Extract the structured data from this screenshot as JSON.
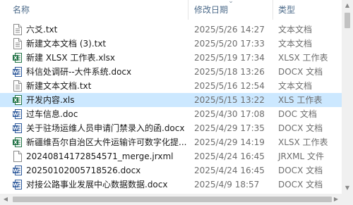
{
  "header": {
    "name": "名称",
    "date": "修改日期",
    "type": "类型"
  },
  "files": [
    {
      "name": "六爻.txt",
      "date": "2025/5/26 14:27",
      "type": "文本文档",
      "icon": "txt-file-icon",
      "selected": false
    },
    {
      "name": "新建文本文档 (3).txt",
      "date": "2025/5/20 17:33",
      "type": "文本文档",
      "icon": "txt-file-icon",
      "selected": false
    },
    {
      "name": "新建 XLSX 工作表.xlsx",
      "date": "2025/5/19 17:34",
      "type": "XLSX 工作表",
      "icon": "xlsx-file-icon",
      "selected": false
    },
    {
      "name": "科信处调研--大件系统.docx",
      "date": "2025/5/18 13:26",
      "type": "DOCX 文档",
      "icon": "docx-file-icon",
      "selected": false
    },
    {
      "name": "新建文本文档.txt",
      "date": "2025/5/16 12:54",
      "type": "文本文档",
      "icon": "txt-file-icon",
      "selected": false
    },
    {
      "name": "开发内容.xls",
      "date": "2025/5/15 13:22",
      "type": "XLS 工作表",
      "icon": "xls-file-icon",
      "selected": true
    },
    {
      "name": "过车信息.doc",
      "date": "2025/4/30 17:08",
      "type": "DOC 文档",
      "icon": "doc-file-icon",
      "selected": false
    },
    {
      "name": "关于驻场运维人员申请门禁录入的函.docx",
      "date": "2025/4/29 17:35",
      "type": "DOCX 文档",
      "icon": "docx-file-icon",
      "selected": false
    },
    {
      "name": "新疆维吾尔自治区大件运输许可数字化提...",
      "date": "2025/4/29 14:19",
      "type": "XLSX 工作表",
      "icon": "xlsx-file-icon",
      "selected": false
    },
    {
      "name": "20240814172854571_merge.jrxml",
      "date": "2025/4/24 16:45",
      "type": "JRXML 文件",
      "icon": "generic-file-icon",
      "selected": false
    },
    {
      "name": "20250102005718526.docx",
      "date": "2025/4/24 16:45",
      "type": "DOCX 文档",
      "icon": "docx-file-icon",
      "selected": false
    },
    {
      "name": "对接公路事业发展中心数据数据.docx",
      "date": "2025/4/9 18:57",
      "type": "DOCX 文档",
      "icon": "docx-file-icon",
      "selected": false
    }
  ],
  "colors": {
    "selection": "#cce8ff",
    "header_text": "#4d6b8a",
    "word_blue": "#2b579a",
    "excel_green": "#217346"
  }
}
